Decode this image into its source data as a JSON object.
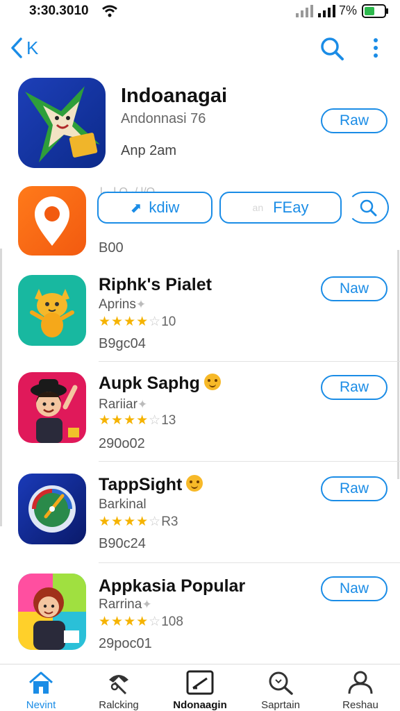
{
  "status": {
    "time": "3:30.3010",
    "battery": "7%"
  },
  "nav": {
    "back_label": "K"
  },
  "hero": {
    "title": "Indoanagai",
    "developer": "Andonnasi 76",
    "subtitle": "Anp 2am",
    "button": "Raw"
  },
  "action_row": {
    "ghost_text": "l-·-l  O ·/ l/O",
    "download_label": "kdiw",
    "play_prefix": "an",
    "play_label": "FEay",
    "size": "B00"
  },
  "apps": [
    {
      "name": "Riphk's Pialet",
      "category": "Aprins",
      "rating_count": "10",
      "stars": 4.5,
      "size": "B9gc04",
      "button": "Naw"
    },
    {
      "name": "Aupk Saphg",
      "category": "Rariiar",
      "rating_count": "13",
      "stars": 4.5,
      "size": "290o02",
      "button": "Raw"
    },
    {
      "name": "TappSight",
      "category": "Barkinal",
      "rating_count": "R3",
      "stars": 4.5,
      "size": "B90c24",
      "button": "Raw"
    },
    {
      "name": "Appkasia Popular",
      "category": "Rarrina",
      "rating_count": "108",
      "stars": 4.5,
      "size": "29poc01",
      "button": "Naw"
    }
  ],
  "tabs": [
    {
      "label": "Nevint",
      "icon": "home-icon",
      "active": true
    },
    {
      "label": "Ralcking",
      "icon": "ranking-icon",
      "active": false
    },
    {
      "label": "Ndonaagin",
      "icon": "apps-icon",
      "active": false
    },
    {
      "label": "Saprtain",
      "icon": "search-icon",
      "active": false
    },
    {
      "label": "Reshau",
      "icon": "profile-icon",
      "active": false
    }
  ],
  "colors": {
    "accent": "#1a8ce6",
    "star": "#f5b301"
  }
}
